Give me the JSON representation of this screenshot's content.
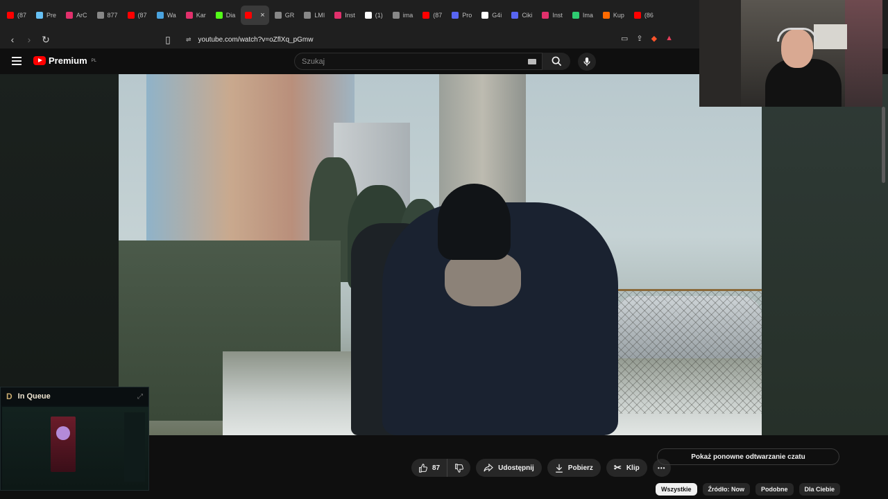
{
  "browser": {
    "tabs": [
      {
        "label": "(87",
        "color": "#ff0000"
      },
      {
        "label": "Pre",
        "color": "#66c0f4"
      },
      {
        "label": "ArC",
        "color": "#e1306c"
      },
      {
        "label": "877",
        "color": "#888888"
      },
      {
        "label": "(87",
        "color": "#ff0000"
      },
      {
        "label": "Wa",
        "color": "#4aa3df"
      },
      {
        "label": "Kar",
        "color": "#e1306c"
      },
      {
        "label": "Dia",
        "color": "#53fc18"
      },
      {
        "label": "",
        "color": "#ff0000",
        "active": true
      },
      {
        "label": "GR",
        "color": "#888888"
      },
      {
        "label": "LMI",
        "color": "#888888"
      },
      {
        "label": "Inst",
        "color": "#e1306c"
      },
      {
        "label": "(1)",
        "color": "#ffffff"
      },
      {
        "label": "ima",
        "color": "#888888"
      },
      {
        "label": "(87",
        "color": "#ff0000"
      },
      {
        "label": "Pro",
        "color": "#5865f2"
      },
      {
        "label": "G4i",
        "color": "#ffffff"
      },
      {
        "label": "Ciki",
        "color": "#5865f2"
      },
      {
        "label": "Inst",
        "color": "#e1306c"
      },
      {
        "label": "Ima",
        "color": "#2ecc71"
      },
      {
        "label": "Kup",
        "color": "#ff6a00"
      },
      {
        "label": "(86",
        "color": "#ff0000"
      }
    ],
    "url": "youtube.com/watch?v=oZflXq_pGmw"
  },
  "youtube": {
    "logo_text": "Premium",
    "region": "PL",
    "search_placeholder": "Szukaj"
  },
  "video_actions": {
    "like_count": "87",
    "share_label": "Udostępnij",
    "download_label": "Pobierz",
    "clip_label": "Klip",
    "more_label": "•••"
  },
  "chat": {
    "replay_label": "Pokaż ponowne odtwarzanie czatu"
  },
  "chips": [
    "Wszystkie",
    "Źródło: Now",
    "Podobne",
    "Dla Ciebie"
  ],
  "overlay": {
    "queue_title": "In Queue"
  }
}
